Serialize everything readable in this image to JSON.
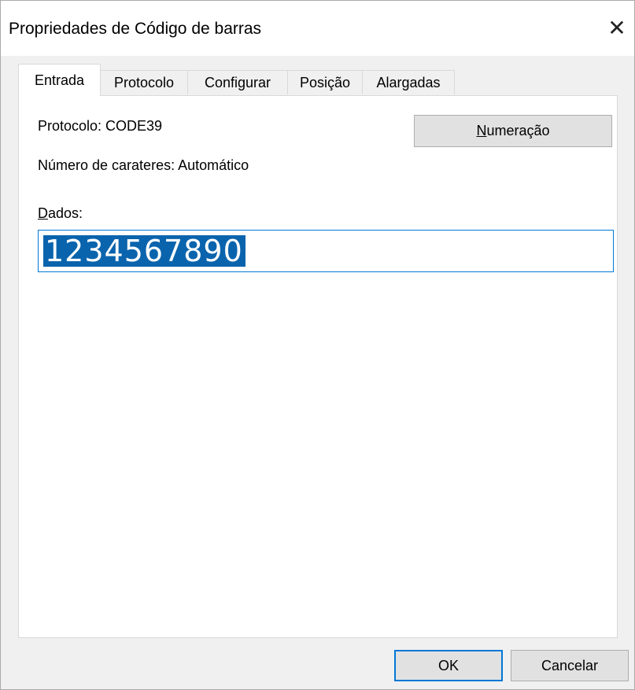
{
  "window": {
    "title": "Propriedades de Código de barras"
  },
  "tabs": [
    {
      "label": "Entrada",
      "active": true
    },
    {
      "label": "Protocolo"
    },
    {
      "label": "Configurar"
    },
    {
      "label": "Posição"
    },
    {
      "label": "Alargadas"
    }
  ],
  "entrada": {
    "protocol_text": "Protocolo: CODE39",
    "char_count_text": "Número de carateres: Automático",
    "numbering_button": {
      "mnemonic": "N",
      "rest": "umeração"
    },
    "data_label": {
      "mnemonic": "D",
      "rest": "ados:"
    },
    "data_value": "1234567890"
  },
  "footer": {
    "ok_label": "OK",
    "cancel_label": "Cancelar"
  },
  "colors": {
    "accent": "#0078d7",
    "selection": "#0a64ad"
  }
}
